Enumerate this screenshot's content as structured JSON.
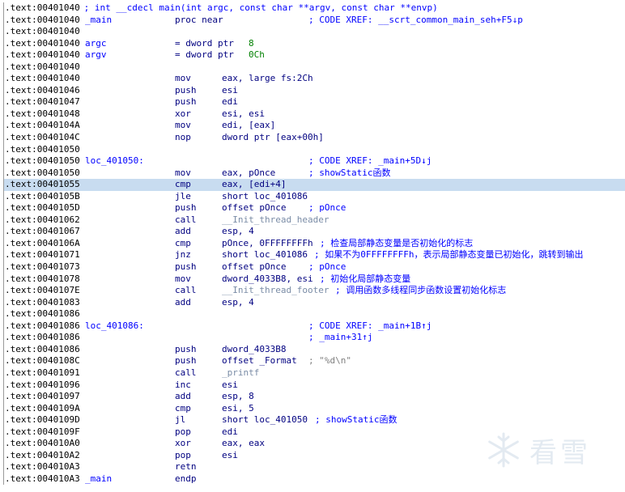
{
  "lines": [
    {
      "addr": ".text:00401040",
      "text": " ; int __cdecl main(int argc, const char **argv, const char **envp)"
    },
    {
      "addr": ".text:00401040",
      "label": "_main",
      "mnem": "proc near",
      "comment": "; CODE XREF: __scrt_common_main_seh+F5↓p"
    },
    {
      "addr": ".text:00401040"
    },
    {
      "addr": ".text:00401040",
      "label": "argc",
      "mnem": "= dword ptr",
      "op_num": "8"
    },
    {
      "addr": ".text:00401040",
      "label": "argv",
      "mnem": "= dword ptr",
      "op_num": "0Ch"
    },
    {
      "addr": ".text:00401040"
    },
    {
      "addr": ".text:00401040",
      "mnem": "mov",
      "operand": "eax, large fs:2Ch"
    },
    {
      "addr": ".text:00401046",
      "mnem": "push",
      "operand": "esi"
    },
    {
      "addr": ".text:00401047",
      "mnem": "push",
      "operand": "edi"
    },
    {
      "addr": ".text:00401048",
      "mnem": "xor",
      "operand": "esi, esi"
    },
    {
      "addr": ".text:0040104A",
      "mnem": "mov",
      "operand": "edi, [eax]"
    },
    {
      "addr": ".text:0040104C",
      "mnem": "nop",
      "operand": "dword ptr [eax+00h]"
    },
    {
      "addr": ".text:00401050"
    },
    {
      "addr": ".text:00401050",
      "label": "loc_401050:",
      "comment": "; CODE XREF: _main+5D↓j"
    },
    {
      "addr": ".text:00401050",
      "mnem": "mov",
      "operand": "eax, pOnce",
      "comment": "; showStatic函数"
    },
    {
      "addr": ".text:00401055",
      "mnem": "cmp",
      "operand": "eax, [edi+4]",
      "highlight": true
    },
    {
      "addr": ".text:0040105B",
      "mnem": "jle",
      "operand": "short loc_401086"
    },
    {
      "addr": ".text:0040105D",
      "mnem": "push",
      "operand": "offset pOnce",
      "comment": "; pOnce"
    },
    {
      "addr": ".text:00401062",
      "mnem": "call",
      "op_imp": "__Init_thread_header"
    },
    {
      "addr": ".text:00401067",
      "mnem": "add",
      "operand": "esp, 4"
    },
    {
      "addr": ".text:0040106A",
      "mnem": "cmp",
      "operand": "pOnce, 0FFFFFFFFh",
      "comment": "; 检查局部静态变量是否初始化的标志"
    },
    {
      "addr": ".text:00401071",
      "mnem": "jnz",
      "operand": "short loc_401086",
      "comment": "; 如果不为0FFFFFFFFh，表示局部静态变量已初始化，跳转到输出"
    },
    {
      "addr": ".text:00401073",
      "mnem": "push",
      "operand": "offset pOnce",
      "comment": "; pOnce"
    },
    {
      "addr": ".text:00401078",
      "mnem": "mov",
      "operand": "dword_4033B8, esi",
      "comment": "; 初始化局部静态变量"
    },
    {
      "addr": ".text:0040107E",
      "mnem": "call",
      "op_imp": "__Init_thread_footer",
      "comment": "; 调用函数多线程同步函数设置初始化标志"
    },
    {
      "addr": ".text:00401083",
      "mnem": "add",
      "operand": "esp, 4"
    },
    {
      "addr": ".text:00401086"
    },
    {
      "addr": ".text:00401086",
      "label": "loc_401086:",
      "comment": "; CODE XREF: _main+1B↑j"
    },
    {
      "addr": ".text:00401086",
      "comment": "; _main+31↑j"
    },
    {
      "addr": ".text:00401086",
      "mnem": "push",
      "operand": "dword_4033B8"
    },
    {
      "addr": ".text:0040108C",
      "mnem": "push",
      "operand": "offset _Format",
      "str": "; \"%d\\n\""
    },
    {
      "addr": ".text:00401091",
      "mnem": "call",
      "op_imp": "_printf"
    },
    {
      "addr": ".text:00401096",
      "mnem": "inc",
      "operand": "esi"
    },
    {
      "addr": ".text:00401097",
      "mnem": "add",
      "operand": "esp, 8"
    },
    {
      "addr": ".text:0040109A",
      "mnem": "cmp",
      "operand": "esi, 5"
    },
    {
      "addr": ".text:0040109D",
      "mnem": "jl",
      "operand": "short loc_401050",
      "comment_inline": "; showStatic函数"
    },
    {
      "addr": ".text:0040109F",
      "mnem": "pop",
      "operand": "edi"
    },
    {
      "addr": ".text:004010A0",
      "mnem": "xor",
      "operand": "eax, eax"
    },
    {
      "addr": ".text:004010A2",
      "mnem": "pop",
      "operand": "esi"
    },
    {
      "addr": ".text:004010A3",
      "mnem": "retn"
    },
    {
      "addr": ".text:004010A3",
      "label": "_main",
      "mnem": "endp"
    }
  ],
  "watermark": {
    "text": "看雪",
    "icon": "snowflake-icon"
  },
  "colors": {
    "address": "#000000",
    "label": "#0000ff",
    "mnemonic": "#000080",
    "comment": "#0000ff",
    "number": "#008000",
    "import": "#7a8ca6",
    "highlight": "#c8dcf0"
  }
}
